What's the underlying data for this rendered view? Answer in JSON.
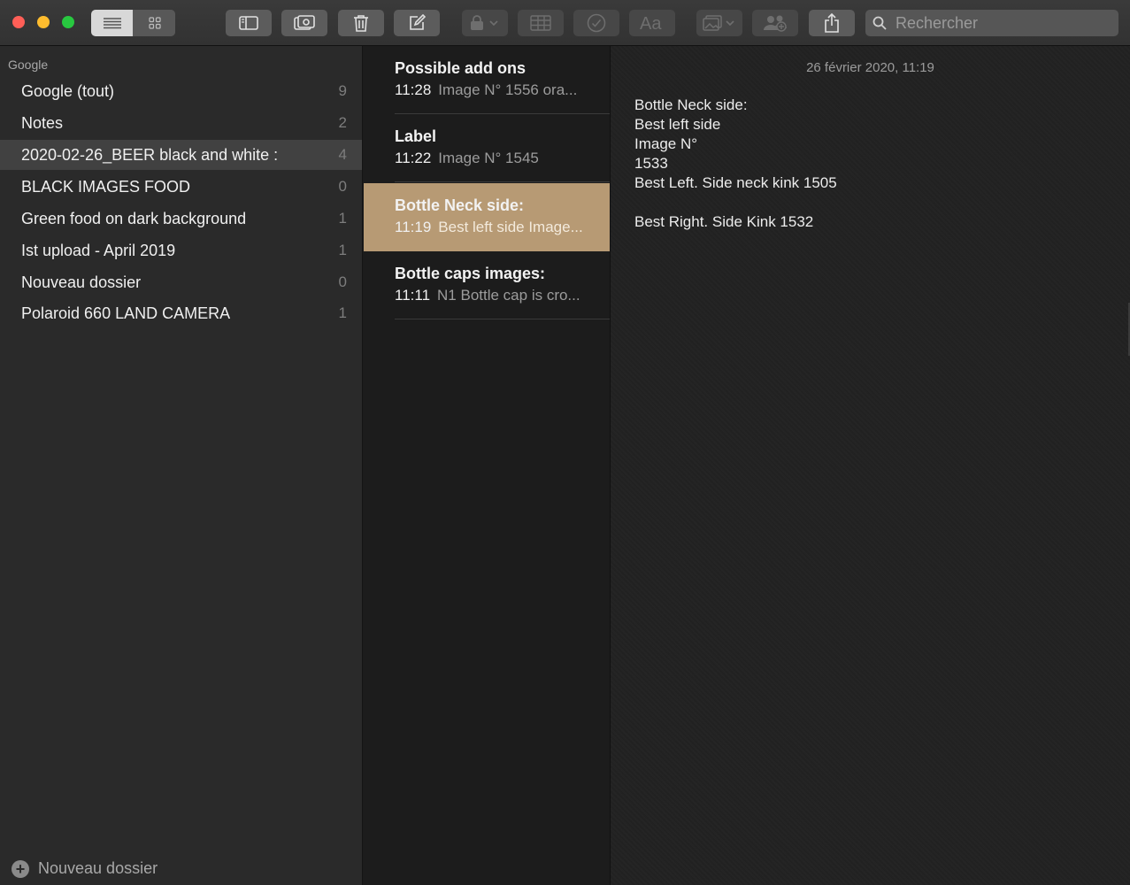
{
  "toolbar": {
    "search_placeholder": "Rechercher",
    "icons": [
      "list-view-icon",
      "gallery-view-icon",
      "sidebar-icon",
      "attachments-icon",
      "trash-icon",
      "compose-icon",
      "lock-icon",
      "table-icon",
      "checklist-icon",
      "format-icon",
      "media-icon",
      "collaborate-icon",
      "share-icon",
      "search-icon"
    ]
  },
  "sidebar": {
    "header": "Google",
    "items": [
      {
        "label": "Google (tout)",
        "count": "9"
      },
      {
        "label": "Notes",
        "count": "2"
      },
      {
        "label": "2020-02-26_BEER black and white :",
        "count": "4"
      },
      {
        "label": "BLACK IMAGES FOOD",
        "count": "0"
      },
      {
        "label": "Green food on dark background",
        "count": "1"
      },
      {
        "label": "Ist upload - April 2019",
        "count": "1"
      },
      {
        "label": "Nouveau dossier",
        "count": "0"
      },
      {
        "label": "Polaroid 660 LAND CAMERA",
        "count": "1"
      }
    ],
    "selected_index": 2,
    "footer": "Nouveau dossier"
  },
  "notes": [
    {
      "title": "Possible add ons",
      "time": "11:28",
      "preview": "Image N° 1556 ora..."
    },
    {
      "title": "Label",
      "time": "11:22",
      "preview": "Image N° 1545"
    },
    {
      "title": "Bottle Neck side:",
      "time": "11:19",
      "preview": "Best left side Image..."
    },
    {
      "title": "Bottle caps images:",
      "time": "11:11",
      "preview": "N1 Bottle cap is cro..."
    }
  ],
  "editor": {
    "date": "26 février 2020, 11:19",
    "lines": [
      "Bottle Neck side:",
      "Best left side",
      "Image N°",
      "1533",
      "Best Left. Side neck kink 1505",
      "",
      "Best Right. Side Kink 1532"
    ]
  },
  "colors": {
    "selected_note": "#b79a74",
    "close": "#ff5f57",
    "minimize": "#febc2e",
    "zoom": "#28c840"
  }
}
